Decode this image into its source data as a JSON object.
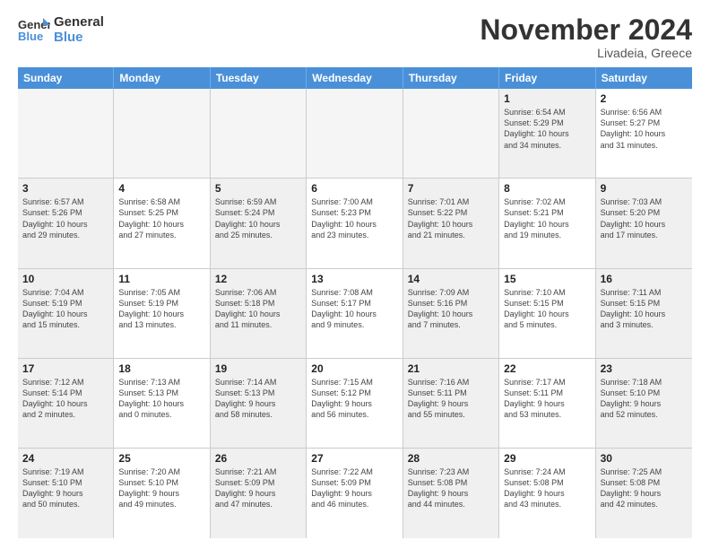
{
  "logo": {
    "line1": "General",
    "line2": "Blue"
  },
  "title": "November 2024",
  "subtitle": "Livadeia, Greece",
  "weekdays": [
    "Sunday",
    "Monday",
    "Tuesday",
    "Wednesday",
    "Thursday",
    "Friday",
    "Saturday"
  ],
  "weeks": [
    [
      {
        "day": "",
        "info": "",
        "empty": true
      },
      {
        "day": "",
        "info": "",
        "empty": true
      },
      {
        "day": "",
        "info": "",
        "empty": true
      },
      {
        "day": "",
        "info": "",
        "empty": true
      },
      {
        "day": "",
        "info": "",
        "empty": true
      },
      {
        "day": "1",
        "info": "Sunrise: 6:54 AM\nSunset: 5:29 PM\nDaylight: 10 hours\nand 34 minutes.",
        "empty": false,
        "shaded": true
      },
      {
        "day": "2",
        "info": "Sunrise: 6:56 AM\nSunset: 5:27 PM\nDaylight: 10 hours\nand 31 minutes.",
        "empty": false,
        "shaded": false
      }
    ],
    [
      {
        "day": "3",
        "info": "Sunrise: 6:57 AM\nSunset: 5:26 PM\nDaylight: 10 hours\nand 29 minutes.",
        "empty": false,
        "shaded": true
      },
      {
        "day": "4",
        "info": "Sunrise: 6:58 AM\nSunset: 5:25 PM\nDaylight: 10 hours\nand 27 minutes.",
        "empty": false,
        "shaded": false
      },
      {
        "day": "5",
        "info": "Sunrise: 6:59 AM\nSunset: 5:24 PM\nDaylight: 10 hours\nand 25 minutes.",
        "empty": false,
        "shaded": true
      },
      {
        "day": "6",
        "info": "Sunrise: 7:00 AM\nSunset: 5:23 PM\nDaylight: 10 hours\nand 23 minutes.",
        "empty": false,
        "shaded": false
      },
      {
        "day": "7",
        "info": "Sunrise: 7:01 AM\nSunset: 5:22 PM\nDaylight: 10 hours\nand 21 minutes.",
        "empty": false,
        "shaded": true
      },
      {
        "day": "8",
        "info": "Sunrise: 7:02 AM\nSunset: 5:21 PM\nDaylight: 10 hours\nand 19 minutes.",
        "empty": false,
        "shaded": false
      },
      {
        "day": "9",
        "info": "Sunrise: 7:03 AM\nSunset: 5:20 PM\nDaylight: 10 hours\nand 17 minutes.",
        "empty": false,
        "shaded": true
      }
    ],
    [
      {
        "day": "10",
        "info": "Sunrise: 7:04 AM\nSunset: 5:19 PM\nDaylight: 10 hours\nand 15 minutes.",
        "empty": false,
        "shaded": true
      },
      {
        "day": "11",
        "info": "Sunrise: 7:05 AM\nSunset: 5:19 PM\nDaylight: 10 hours\nand 13 minutes.",
        "empty": false,
        "shaded": false
      },
      {
        "day": "12",
        "info": "Sunrise: 7:06 AM\nSunset: 5:18 PM\nDaylight: 10 hours\nand 11 minutes.",
        "empty": false,
        "shaded": true
      },
      {
        "day": "13",
        "info": "Sunrise: 7:08 AM\nSunset: 5:17 PM\nDaylight: 10 hours\nand 9 minutes.",
        "empty": false,
        "shaded": false
      },
      {
        "day": "14",
        "info": "Sunrise: 7:09 AM\nSunset: 5:16 PM\nDaylight: 10 hours\nand 7 minutes.",
        "empty": false,
        "shaded": true
      },
      {
        "day": "15",
        "info": "Sunrise: 7:10 AM\nSunset: 5:15 PM\nDaylight: 10 hours\nand 5 minutes.",
        "empty": false,
        "shaded": false
      },
      {
        "day": "16",
        "info": "Sunrise: 7:11 AM\nSunset: 5:15 PM\nDaylight: 10 hours\nand 3 minutes.",
        "empty": false,
        "shaded": true
      }
    ],
    [
      {
        "day": "17",
        "info": "Sunrise: 7:12 AM\nSunset: 5:14 PM\nDaylight: 10 hours\nand 2 minutes.",
        "empty": false,
        "shaded": true
      },
      {
        "day": "18",
        "info": "Sunrise: 7:13 AM\nSunset: 5:13 PM\nDaylight: 10 hours\nand 0 minutes.",
        "empty": false,
        "shaded": false
      },
      {
        "day": "19",
        "info": "Sunrise: 7:14 AM\nSunset: 5:13 PM\nDaylight: 9 hours\nand 58 minutes.",
        "empty": false,
        "shaded": true
      },
      {
        "day": "20",
        "info": "Sunrise: 7:15 AM\nSunset: 5:12 PM\nDaylight: 9 hours\nand 56 minutes.",
        "empty": false,
        "shaded": false
      },
      {
        "day": "21",
        "info": "Sunrise: 7:16 AM\nSunset: 5:11 PM\nDaylight: 9 hours\nand 55 minutes.",
        "empty": false,
        "shaded": true
      },
      {
        "day": "22",
        "info": "Sunrise: 7:17 AM\nSunset: 5:11 PM\nDaylight: 9 hours\nand 53 minutes.",
        "empty": false,
        "shaded": false
      },
      {
        "day": "23",
        "info": "Sunrise: 7:18 AM\nSunset: 5:10 PM\nDaylight: 9 hours\nand 52 minutes.",
        "empty": false,
        "shaded": true
      }
    ],
    [
      {
        "day": "24",
        "info": "Sunrise: 7:19 AM\nSunset: 5:10 PM\nDaylight: 9 hours\nand 50 minutes.",
        "empty": false,
        "shaded": true
      },
      {
        "day": "25",
        "info": "Sunrise: 7:20 AM\nSunset: 5:10 PM\nDaylight: 9 hours\nand 49 minutes.",
        "empty": false,
        "shaded": false
      },
      {
        "day": "26",
        "info": "Sunrise: 7:21 AM\nSunset: 5:09 PM\nDaylight: 9 hours\nand 47 minutes.",
        "empty": false,
        "shaded": true
      },
      {
        "day": "27",
        "info": "Sunrise: 7:22 AM\nSunset: 5:09 PM\nDaylight: 9 hours\nand 46 minutes.",
        "empty": false,
        "shaded": false
      },
      {
        "day": "28",
        "info": "Sunrise: 7:23 AM\nSunset: 5:08 PM\nDaylight: 9 hours\nand 44 minutes.",
        "empty": false,
        "shaded": true
      },
      {
        "day": "29",
        "info": "Sunrise: 7:24 AM\nSunset: 5:08 PM\nDaylight: 9 hours\nand 43 minutes.",
        "empty": false,
        "shaded": false
      },
      {
        "day": "30",
        "info": "Sunrise: 7:25 AM\nSunset: 5:08 PM\nDaylight: 9 hours\nand 42 minutes.",
        "empty": false,
        "shaded": true
      }
    ]
  ]
}
